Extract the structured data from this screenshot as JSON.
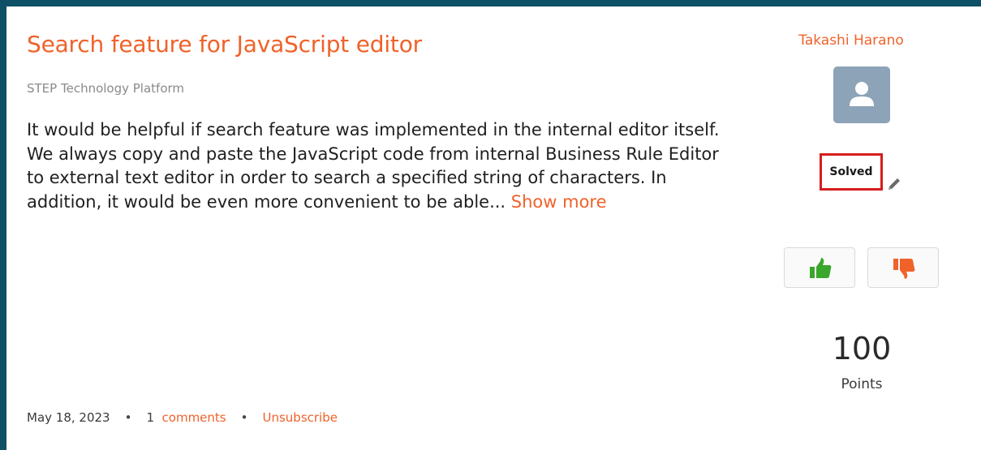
{
  "idea": {
    "title": "Search feature for JavaScript editor",
    "category": "STEP Technology Platform",
    "description": "It would be helpful if search feature was implemented in the internal editor itself. We always copy and paste the JavaScript code from internal Business Rule Editor to external text editor in order to search a specified string of characters. In addition, it would be even more convenient to be able... ",
    "show_more_label": "Show more"
  },
  "meta": {
    "date": "May 18, 2023",
    "separator": "•",
    "comments_count": "1",
    "comments_label": "comments",
    "unsubscribe_label": "Unsubscribe"
  },
  "sidebar": {
    "author": "Takashi Harano",
    "avatar_icon": "user-icon",
    "status": "Solved",
    "edit_icon": "pencil-icon",
    "vote_up_icon": "thumbs-up-icon",
    "vote_down_icon": "thumbs-down-icon",
    "points": "100",
    "points_label": "Points"
  },
  "colors": {
    "accent": "#f0622a",
    "frame": "#0e5166",
    "status_border": "#d81c1c",
    "vote_up": "#3aa62b",
    "vote_down": "#f0622a",
    "avatar_bg": "#8da3b7"
  }
}
